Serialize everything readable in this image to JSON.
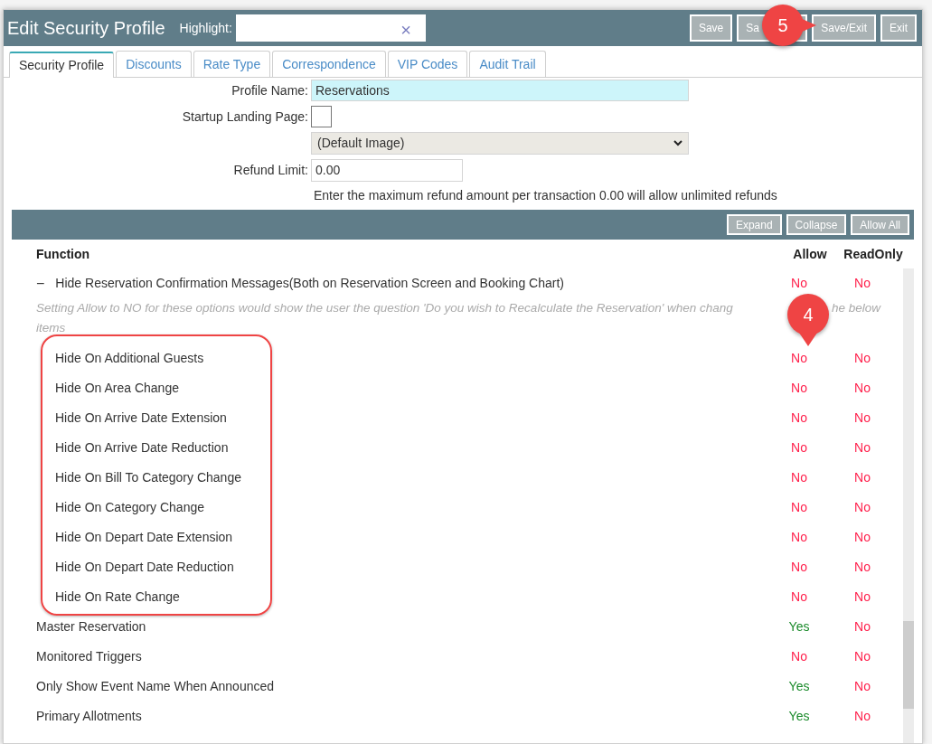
{
  "window": {
    "title": "Edit Security Profile"
  },
  "highlight": {
    "label": "Highlight:",
    "clear": "×"
  },
  "header_buttons": [
    {
      "label": "Save"
    },
    {
      "label": "Sa"
    },
    {
      "label": "Save/Exit"
    },
    {
      "label": "Exit"
    }
  ],
  "callouts": [
    {
      "number": "5"
    },
    {
      "number": "4"
    }
  ],
  "tabs": [
    {
      "label": "Security Profile",
      "selected": true
    },
    {
      "label": "Discounts",
      "selected": false
    },
    {
      "label": "Rate Type",
      "selected": false
    },
    {
      "label": "Correspondence",
      "selected": false
    },
    {
      "label": "VIP Codes",
      "selected": false
    },
    {
      "label": "Audit Trail",
      "selected": false
    }
  ],
  "form": {
    "profile_name": {
      "label": "Profile Name:",
      "value": "Reservations"
    },
    "startup_landing_page": {
      "label": "Startup Landing Page:",
      "checked": false,
      "select": "(Default Image)"
    },
    "refund_limit": {
      "label": "Refund Limit:",
      "value": "0.00",
      "help": "Enter the maximum refund amount per transaction 0.00 will allow unlimited refunds"
    }
  },
  "toolbar": [
    "Expand",
    "Collapse",
    "Allow All"
  ],
  "table": {
    "columns": [
      "Function",
      "Allow",
      "ReadOnly"
    ],
    "rows": [
      {
        "name": "Hide Reservation Confirmation Messages(Both on Reservation Screen and Booking Chart)",
        "toggle": "−",
        "expanded": true,
        "allow": "No",
        "allowed": false,
        "readonly": "No",
        "readonly_on": false,
        "hint": [
          "Setting Allow to NO for these options would show the user the question 'Do you wish to Recalculate the Reservation' when chang",
          "he below",
          "items"
        ],
        "children": [
          {
            "name": "Hide On Additional Guests",
            "allow": "No",
            "allowed": false,
            "readonly": "No",
            "readonly_on": false
          },
          {
            "name": "Hide On Area Change",
            "allow": "No",
            "allowed": false,
            "readonly": "No",
            "readonly_on": false
          },
          {
            "name": "Hide On Arrive Date Extension",
            "allow": "No",
            "allowed": false,
            "readonly": "No",
            "readonly_on": false
          },
          {
            "name": "Hide On Arrive Date Reduction",
            "allow": "No",
            "allowed": false,
            "readonly": "No",
            "readonly_on": false
          },
          {
            "name": "Hide On Bill To Category Change",
            "allow": "No",
            "allowed": false,
            "readonly": "No",
            "readonly_on": false
          },
          {
            "name": "Hide On Category Change",
            "allow": "No",
            "allowed": false,
            "readonly": "No",
            "readonly_on": false
          },
          {
            "name": "Hide On Depart Date Extension",
            "allow": "No",
            "allowed": false,
            "readonly": "No",
            "readonly_on": false
          },
          {
            "name": "Hide On Depart Date Reduction",
            "allow": "No",
            "allowed": false,
            "readonly": "No",
            "readonly_on": false
          },
          {
            "name": "Hide On Rate Change",
            "allow": "No",
            "allowed": false,
            "readonly": "No",
            "readonly_on": false
          }
        ]
      },
      {
        "name": "Master Reservation",
        "allow": "Yes",
        "allowed": true,
        "readonly": "No",
        "readonly_on": false
      },
      {
        "name": "Monitored Triggers",
        "allow": "No",
        "allowed": false,
        "readonly": "No",
        "readonly_on": false
      },
      {
        "name": "Only Show Event Name When Announced",
        "allow": "Yes",
        "allowed": true,
        "readonly": "No",
        "readonly_on": false
      },
      {
        "name": "Primary Allotments",
        "allow": "Yes",
        "allowed": true,
        "readonly": "No",
        "readonly_on": false
      }
    ]
  }
}
